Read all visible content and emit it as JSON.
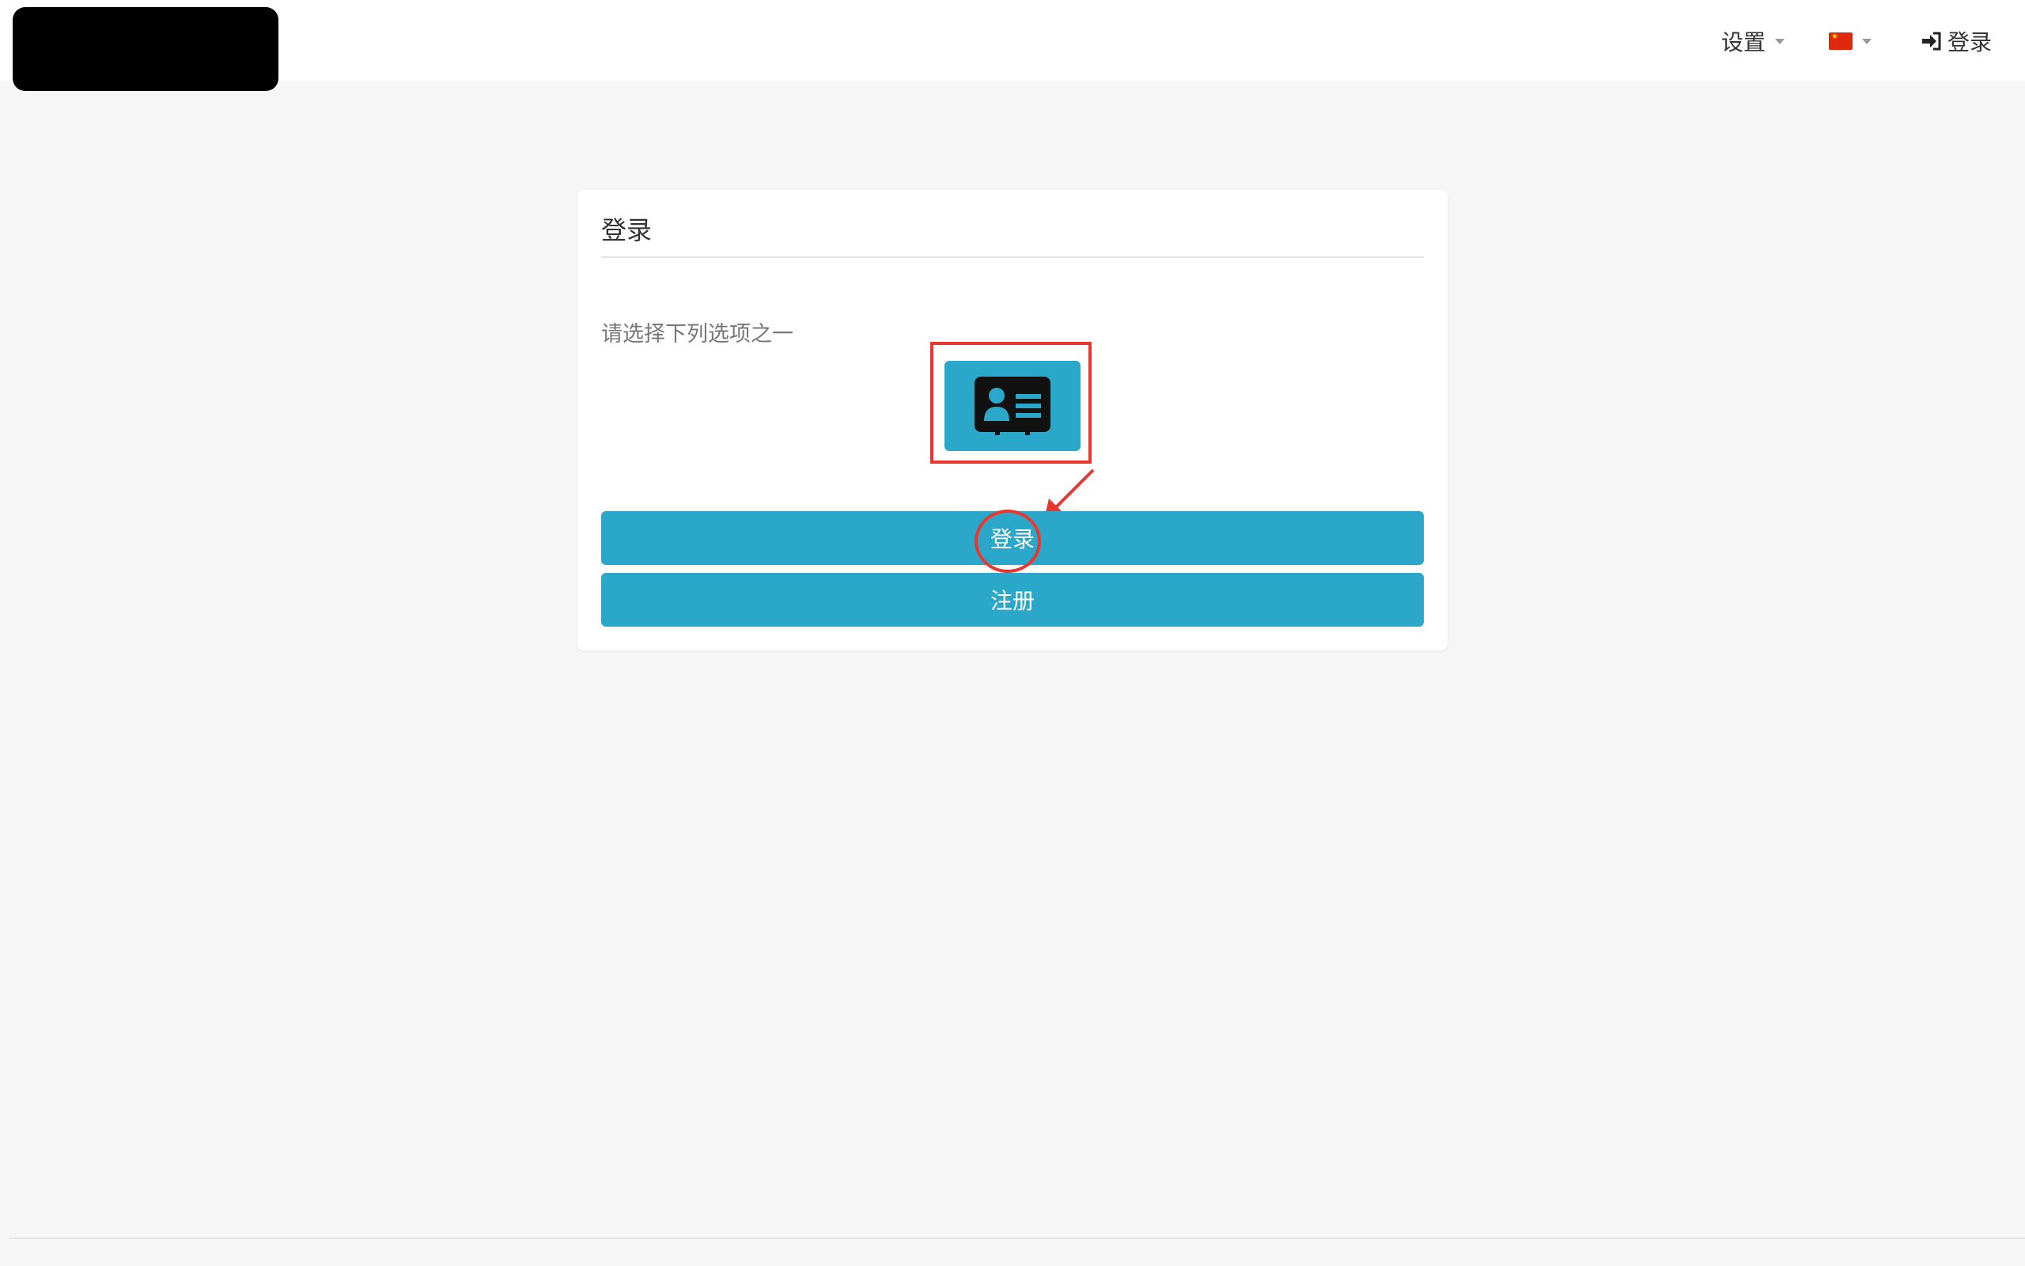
{
  "navbar": {
    "settings_label": "设置",
    "login_label": "登录",
    "icons": {
      "settings_caret": "caret-down-icon",
      "language_flag": "china-flag-icon",
      "language_caret": "caret-down-icon",
      "login": "sign-in-icon"
    }
  },
  "panel": {
    "title": "登录",
    "hint": "请选择下列选项之一",
    "option_icon": "id-card-icon",
    "login_button": "登录",
    "register_button": "注册"
  },
  "colors": {
    "accent": "#2ba8c9",
    "annotation": "#e8372e",
    "background": "#f6f6f6",
    "card": "#ffffff"
  }
}
